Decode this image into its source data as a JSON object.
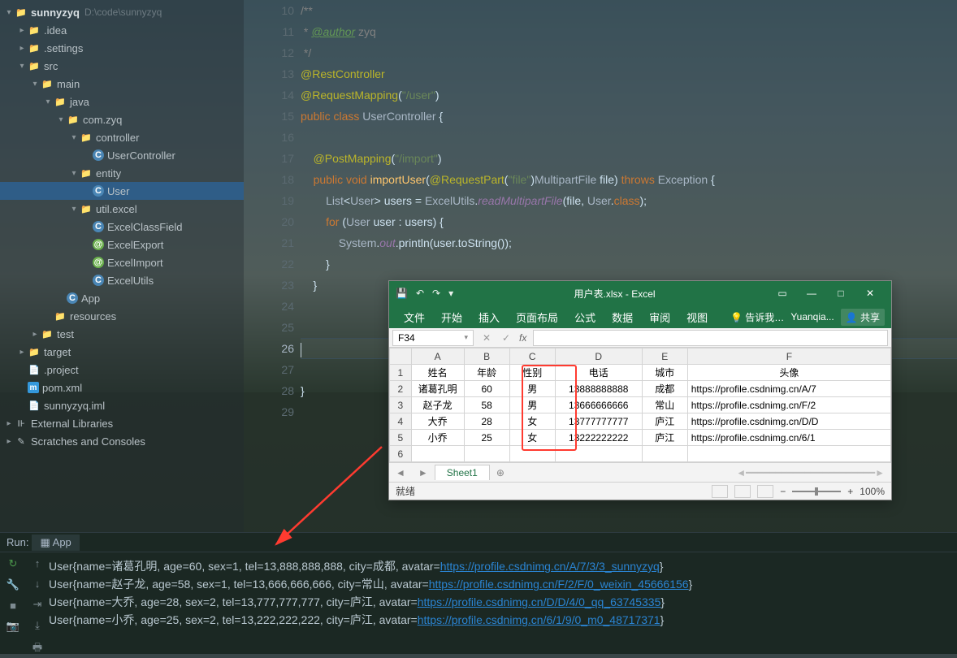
{
  "project": {
    "root": "sunnyzyq",
    "root_path": "D:\\code\\sunnyzyq",
    "tree": [
      {
        "label": ".idea",
        "depth": 1,
        "expander": "▸",
        "icon": "folder"
      },
      {
        "label": ".settings",
        "depth": 1,
        "expander": "▸",
        "icon": "folder"
      },
      {
        "label": "src",
        "depth": 1,
        "expander": "▾",
        "icon": "folder-blue"
      },
      {
        "label": "main",
        "depth": 2,
        "expander": "▾",
        "icon": "folder-blue"
      },
      {
        "label": "java",
        "depth": 3,
        "expander": "▾",
        "icon": "folder-blue"
      },
      {
        "label": "com.zyq",
        "depth": 4,
        "expander": "▾",
        "icon": "folder"
      },
      {
        "label": "controller",
        "depth": 5,
        "expander": "▾",
        "icon": "folder"
      },
      {
        "label": "UserController",
        "depth": 6,
        "expander": "",
        "icon": "class"
      },
      {
        "label": "entity",
        "depth": 5,
        "expander": "▾",
        "icon": "folder"
      },
      {
        "label": "User",
        "depth": 6,
        "expander": "",
        "icon": "class",
        "selected": true
      },
      {
        "label": "util.excel",
        "depth": 5,
        "expander": "▾",
        "icon": "folder"
      },
      {
        "label": "ExcelClassField",
        "depth": 6,
        "expander": "",
        "icon": "class"
      },
      {
        "label": "ExcelExport",
        "depth": 6,
        "expander": "",
        "icon": "annotation"
      },
      {
        "label": "ExcelImport",
        "depth": 6,
        "expander": "",
        "icon": "annotation"
      },
      {
        "label": "ExcelUtils",
        "depth": 6,
        "expander": "",
        "icon": "class"
      },
      {
        "label": "App",
        "depth": 4,
        "expander": "",
        "icon": "class"
      },
      {
        "label": "resources",
        "depth": 3,
        "expander": "",
        "icon": "folder-orange"
      },
      {
        "label": "test",
        "depth": 2,
        "expander": "▸",
        "icon": "folder-blue"
      },
      {
        "label": "target",
        "depth": 1,
        "expander": "▸",
        "icon": "folder-orange"
      },
      {
        "label": ".project",
        "depth": 1,
        "expander": "",
        "icon": "file"
      },
      {
        "label": "pom.xml",
        "depth": 1,
        "expander": "",
        "icon": "maven"
      },
      {
        "label": "sunnyzyq.iml",
        "depth": 1,
        "expander": "",
        "icon": "file"
      },
      {
        "label": "External Libraries",
        "depth": 0,
        "expander": "▸",
        "icon": "lib"
      },
      {
        "label": "Scratches and Consoles",
        "depth": 0,
        "expander": "▸",
        "icon": "scratch"
      }
    ]
  },
  "editor": {
    "first_line_no": 10,
    "caret_line": 26,
    "lines": {
      "10": "/**",
      "11": " * @author zyq",
      "12": " */",
      "13": "@RestController",
      "14": "@RequestMapping(\"/user\")",
      "15": "public class UserController {",
      "16": "",
      "17": "    @PostMapping(\"/import\")",
      "18": "    public void importUser(@RequestPart(\"file\")MultipartFile file) throws Exception {",
      "19": "        List<User> users = ExcelUtils.readMultipartFile(file, User.class);",
      "20": "        for (User user : users) {",
      "21": "            System.out.println(user.toString());",
      "22": "        }",
      "23": "    }",
      "24": "",
      "25": "",
      "26": "",
      "27": "",
      "28": "}",
      "29": ""
    }
  },
  "excel": {
    "title": "用户表.xlsx - Excel",
    "ribbon_tabs": [
      "文件",
      "开始",
      "插入",
      "页面布局",
      "公式",
      "数据",
      "审阅",
      "视图"
    ],
    "tell_me": "告诉我…",
    "account": "Yuanqia...",
    "share": "共享",
    "name_box": "F34",
    "fx_label": "fx",
    "headers": [
      "姓名",
      "年龄",
      "性别",
      "电话",
      "城市",
      "头像"
    ],
    "rows": [
      [
        "诸葛孔明",
        "60",
        "男",
        "13888888888",
        "成都",
        "https://profile.csdnimg.cn/A/7"
      ],
      [
        "赵子龙",
        "58",
        "男",
        "13666666666",
        "常山",
        "https://profile.csdnimg.cn/F/2"
      ],
      [
        "大乔",
        "28",
        "女",
        "13777777777",
        "庐江",
        "https://profile.csdnimg.cn/D/D"
      ],
      [
        "小乔",
        "25",
        "女",
        "13222222222",
        "庐江",
        "https://profile.csdnimg.cn/6/1"
      ]
    ],
    "sheet": "Sheet1",
    "status_ready": "就绪",
    "zoom": "100%"
  },
  "run": {
    "title": "Run:",
    "tab": "App",
    "lines": [
      {
        "pre": "User{name=诸葛孔明, age=60, sex=1, tel=13,888,888,888, city=成都, avatar=",
        "link": "https://profile.csdnimg.cn/A/7/3/3_sunnyzyq",
        "post": "}"
      },
      {
        "pre": "User{name=赵子龙, age=58, sex=1, tel=13,666,666,666, city=常山, avatar=",
        "link": "https://profile.csdnimg.cn/F/2/F/0_weixin_45666156",
        "post": "}"
      },
      {
        "pre": "User{name=大乔, age=28, sex=2, tel=13,777,777,777, city=庐江, avatar=",
        "link": "https://profile.csdnimg.cn/D/D/4/0_qq_63745335",
        "post": "}"
      },
      {
        "pre": "User{name=小乔, age=25, sex=2, tel=13,222,222,222, city=庐江, avatar=",
        "link": "https://profile.csdnimg.cn/6/1/9/0_m0_48717371",
        "post": "}"
      }
    ]
  }
}
